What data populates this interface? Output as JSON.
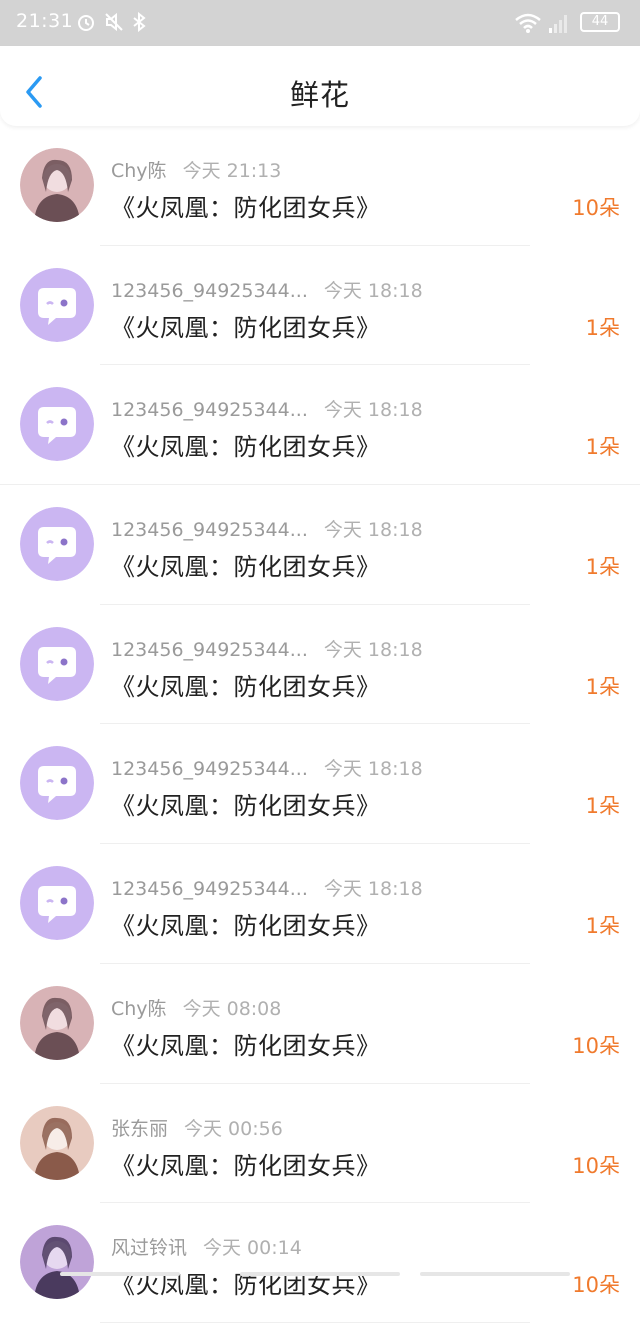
{
  "status_bar": {
    "time": "21:31",
    "battery": "44",
    "icons": [
      "alarm-icon",
      "mute-icon",
      "bluetooth-icon",
      "wifi-icon",
      "signal-icon",
      "battery-icon"
    ]
  },
  "header": {
    "title": "鲜花",
    "back_icon": "chevron-left-icon"
  },
  "colors": {
    "count": "#f07a2d",
    "back": "#2b9af3",
    "default_avatar": "#cbb6f2"
  },
  "items": [
    {
      "name": "Chy陈",
      "time": "今天 21:13",
      "message": "《火凤凰：防化团女兵》",
      "count": "10朵",
      "avatar": "photo"
    },
    {
      "name": "123456_94925344...",
      "time": "今天 18:18",
      "message": "《火凤凰：防化团女兵》",
      "count": "1朵",
      "avatar": "default"
    },
    {
      "name": "123456_94925344...",
      "time": "今天 18:18",
      "message": "《火凤凰：防化团女兵》",
      "count": "1朵",
      "avatar": "default"
    },
    {
      "name": "123456_94925344...",
      "time": "今天 18:18",
      "message": "《火凤凰：防化团女兵》",
      "count": "1朵",
      "avatar": "default"
    },
    {
      "name": "123456_94925344...",
      "time": "今天 18:18",
      "message": "《火凤凰：防化团女兵》",
      "count": "1朵",
      "avatar": "default"
    },
    {
      "name": "123456_94925344...",
      "time": "今天 18:18",
      "message": "《火凤凰：防化团女兵》",
      "count": "1朵",
      "avatar": "default"
    },
    {
      "name": "123456_94925344...",
      "time": "今天 18:18",
      "message": "《火凤凰：防化团女兵》",
      "count": "1朵",
      "avatar": "default"
    },
    {
      "name": "Chy陈",
      "time": "今天 08:08",
      "message": "《火凤凰：防化团女兵》",
      "count": "10朵",
      "avatar": "photo"
    },
    {
      "name": "张东丽",
      "time": "今天 00:56",
      "message": "《火凤凰：防化团女兵》",
      "count": "10朵",
      "avatar": "photo2"
    },
    {
      "name": "风过铃讯",
      "time": "今天 00:14",
      "message": "《火凤凰：防化团女兵》",
      "count": "10朵",
      "avatar": "photo3"
    }
  ]
}
